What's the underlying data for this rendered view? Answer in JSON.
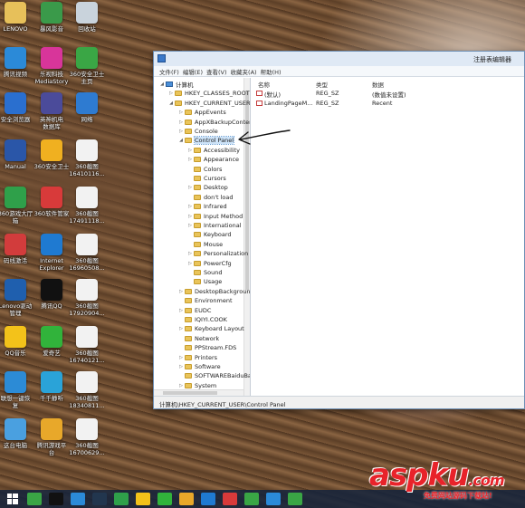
{
  "desktop": {
    "icons": [
      {
        "id": "lenovo",
        "label": "LENOVO",
        "icon": "folder-icon",
        "color": "#e7c05a"
      },
      {
        "id": "fengxing",
        "label": "暴风影音",
        "icon": "app-icon",
        "color": "#3a9a4a"
      },
      {
        "id": "recycle",
        "label": "回收站",
        "icon": "recycle-bin-icon",
        "color": "#c9d3dc"
      },
      {
        "id": "tencent-video",
        "label": "腾讯视频",
        "icon": "video-icon",
        "color": "#2b8ad8"
      },
      {
        "id": "mediastory",
        "label": "乐视科技\nMediaStory",
        "icon": "media-icon",
        "color": "#d8359a"
      },
      {
        "id": "360safe-main",
        "label": "360安全卫士\n主页",
        "icon": "shield-icon",
        "color": "#3aa645"
      },
      {
        "id": "safe-browser",
        "label": "安全浏览器",
        "icon": "browser-icon",
        "color": "#2a6fcf"
      },
      {
        "id": "yingshi",
        "label": "英神机电\n数据库",
        "icon": "app-icon",
        "color": "#4b4b9a"
      },
      {
        "id": "network",
        "label": "网络",
        "icon": "network-icon",
        "color": "#2e7bd1"
      },
      {
        "id": "manual",
        "label": "Manual",
        "icon": "book-icon",
        "color": "#2a56a8"
      },
      {
        "id": "360safe",
        "label": "360安全卫士",
        "icon": "shield-icon",
        "color": "#f0b020"
      },
      {
        "id": "shot1",
        "label": "360截图\n16410116...",
        "icon": "image-icon",
        "color": "#f2f2f2"
      },
      {
        "id": "360game",
        "label": "360游戏大厅\n箱",
        "icon": "game-icon",
        "color": "#2fa04a"
      },
      {
        "id": "360soft",
        "label": "360软件管家",
        "icon": "store-icon",
        "color": "#d83a3a"
      },
      {
        "id": "shot2",
        "label": "360截图\n17491118...",
        "icon": "image-icon",
        "color": "#f2f2f2"
      },
      {
        "id": "yuanbao",
        "label": "码线激活",
        "icon": "app-icon",
        "color": "#d23c3c"
      },
      {
        "id": "ie",
        "label": "Internet\nExplorer",
        "icon": "ie-icon",
        "color": "#1f7ad1"
      },
      {
        "id": "shot3",
        "label": "360截图\n16960508...",
        "icon": "image-icon",
        "color": "#f2f2f2"
      },
      {
        "id": "drivers",
        "label": "Lenovo驱动\n管理",
        "icon": "driver-icon",
        "color": "#1f5fae"
      },
      {
        "id": "qq",
        "label": "腾讯QQ",
        "icon": "penguin-icon",
        "color": "#111111"
      },
      {
        "id": "shot4",
        "label": "360截图\n17920904...",
        "icon": "image-icon",
        "color": "#f2f2f2"
      },
      {
        "id": "qqmusic",
        "label": "QQ音乐",
        "icon": "music-icon",
        "color": "#f3c21a"
      },
      {
        "id": "iqiyi",
        "label": "爱奇艺",
        "icon": "iqiyi-icon",
        "color": "#31b33b"
      },
      {
        "id": "shot5",
        "label": "360截图\n16740121...",
        "icon": "image-icon",
        "color": "#f2f2f2"
      },
      {
        "id": "lianxiang",
        "label": "联想一键恢\n复",
        "icon": "recovery-icon",
        "color": "#2c8bd6"
      },
      {
        "id": "ttplay",
        "label": "千千静听",
        "icon": "player-icon",
        "color": "#2aa3d8"
      },
      {
        "id": "shot6",
        "label": "360截图\n18340811...",
        "icon": "image-icon",
        "color": "#f2f2f2"
      },
      {
        "id": "thispc",
        "label": "这台电脑",
        "icon": "computer-icon",
        "color": "#4aa0e0"
      },
      {
        "id": "wangyou",
        "label": "腾讯游戏平\n台",
        "icon": "game-icon",
        "color": "#e8a82a"
      },
      {
        "id": "shot7",
        "label": "360截图\n16700629...",
        "icon": "image-icon",
        "color": "#f2f2f2"
      }
    ]
  },
  "regedit": {
    "title": "注册表编辑器",
    "menu": [
      "文件(F)",
      "编辑(E)",
      "查看(V)",
      "收藏夹(A)",
      "帮助(H)"
    ],
    "tree": [
      {
        "label": "计算机",
        "level": 0,
        "expanded": true,
        "type": "computer"
      },
      {
        "label": "HKEY_CLASSES_ROOT",
        "level": 1,
        "expanded": false
      },
      {
        "label": "HKEY_CURRENT_USER",
        "level": 1,
        "expanded": true
      },
      {
        "label": "AppEvents",
        "level": 2,
        "expanded": false
      },
      {
        "label": "AppXBackupConter",
        "level": 2,
        "expanded": false
      },
      {
        "label": "Console",
        "level": 2,
        "expanded": false
      },
      {
        "label": "Control Panel",
        "level": 2,
        "expanded": true,
        "selected": true
      },
      {
        "label": "Accessibility",
        "level": 3,
        "expanded": false
      },
      {
        "label": "Appearance",
        "level": 3,
        "expanded": false
      },
      {
        "label": "Colors",
        "level": 3,
        "leaf": true
      },
      {
        "label": "Cursors",
        "level": 3,
        "leaf": true
      },
      {
        "label": "Desktop",
        "level": 3,
        "expanded": false
      },
      {
        "label": "don't load",
        "level": 3,
        "leaf": true
      },
      {
        "label": "Infrared",
        "level": 3,
        "expanded": false
      },
      {
        "label": "Input Method",
        "level": 3,
        "expanded": false
      },
      {
        "label": "International",
        "level": 3,
        "expanded": false
      },
      {
        "label": "Keyboard",
        "level": 3,
        "leaf": true
      },
      {
        "label": "Mouse",
        "level": 3,
        "leaf": true
      },
      {
        "label": "Personalization",
        "level": 3,
        "expanded": false
      },
      {
        "label": "PowerCfg",
        "level": 3,
        "expanded": false
      },
      {
        "label": "Sound",
        "level": 3,
        "leaf": true
      },
      {
        "label": "Usage",
        "level": 3,
        "leaf": true
      },
      {
        "label": "DesktopBackgroun",
        "level": 2,
        "expanded": false
      },
      {
        "label": "Environment",
        "level": 2,
        "leaf": true
      },
      {
        "label": "EUDC",
        "level": 2,
        "expanded": false
      },
      {
        "label": "IQIYI.COOK",
        "level": 2,
        "leaf": true
      },
      {
        "label": "Keyboard Layout",
        "level": 2,
        "expanded": false
      },
      {
        "label": "Network",
        "level": 2,
        "leaf": true
      },
      {
        "label": "PPStream.FDS",
        "level": 2,
        "leaf": true
      },
      {
        "label": "Printers",
        "level": 2,
        "expanded": false
      },
      {
        "label": "Software",
        "level": 2,
        "expanded": false
      },
      {
        "label": "SOFTWAREBaiduBa",
        "level": 2,
        "leaf": true
      },
      {
        "label": "System",
        "level": 2,
        "expanded": false
      }
    ],
    "columns": {
      "name": "名称",
      "type": "类型",
      "data": "数据"
    },
    "values": [
      {
        "name": "(默认)",
        "type": "REG_SZ",
        "data": "(数值未设置)"
      },
      {
        "name": "LandingPageM...",
        "type": "REG_SZ",
        "data": "Recent"
      }
    ],
    "status_path": "计算机\\HKEY_CURRENT_USER\\Control Panel"
  },
  "taskbar": {
    "icons": [
      {
        "name": "start-icon",
        "color": "#1b75c9"
      },
      {
        "name": "app-icon",
        "color": "#3aa645"
      },
      {
        "name": "penguin-icon",
        "color": "#111111"
      },
      {
        "name": "tencent-video-icon",
        "color": "#2b8ad8"
      },
      {
        "name": "book-icon",
        "color": "#22364e"
      },
      {
        "name": "game-icon",
        "color": "#2fa04a"
      },
      {
        "name": "music-icon",
        "color": "#f3c21a"
      },
      {
        "name": "iqiyi-icon",
        "color": "#31b33b"
      },
      {
        "name": "player-icon",
        "color": "#e8a82a"
      },
      {
        "name": "ie-icon",
        "color": "#1f7ad1"
      },
      {
        "name": "store-icon",
        "color": "#d83a3a"
      },
      {
        "name": "shield-icon",
        "color": "#3aa645"
      },
      {
        "name": "video-icon",
        "color": "#2b8ad8"
      },
      {
        "name": "360-icon",
        "color": "#3aa645"
      }
    ]
  },
  "watermark": {
    "brand": "aspku",
    "tld": ".com",
    "slogan": "免费网站源码下载站!"
  }
}
